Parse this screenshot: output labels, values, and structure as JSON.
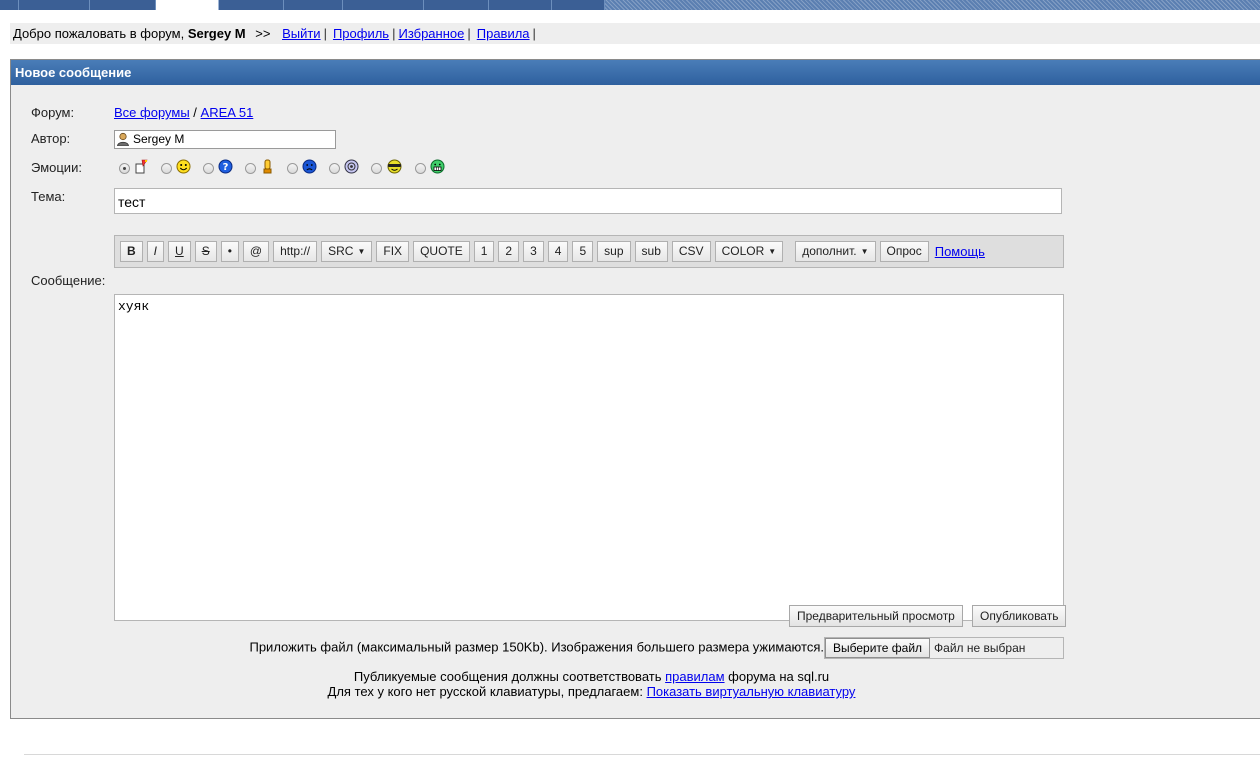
{
  "welcome": {
    "greeting": "Добро пожаловать в форум,",
    "username": "Sergey M",
    "arrows": ">>",
    "links": [
      "Выйти",
      "Профиль",
      "Избранное",
      "Правила"
    ],
    "separator": "|"
  },
  "panel": {
    "title": "Новое сообщение"
  },
  "form": {
    "forum_label": "Форум:",
    "forum_path": [
      "Все форумы",
      "AREA 51"
    ],
    "forum_path_sep": "/",
    "author_label": "Автор:",
    "author_value": "Sergey M",
    "emotions_label": "Эмоции:",
    "emotions": [
      {
        "icon": "pencil-note-icon",
        "checked": true
      },
      {
        "icon": "smiley-icon",
        "checked": false
      },
      {
        "icon": "question-face-icon",
        "checked": false
      },
      {
        "icon": "thumbs-up-icon",
        "checked": false
      },
      {
        "icon": "sad-face-icon",
        "checked": false
      },
      {
        "icon": "dizzy-face-icon",
        "checked": false
      },
      {
        "icon": "cool-face-icon",
        "checked": false
      },
      {
        "icon": "grin-face-icon",
        "checked": false
      }
    ],
    "subject_label": "Тема:",
    "subject_value": "тест",
    "message_label": "Сообщение:",
    "message_value": "хуяк"
  },
  "toolbar": {
    "buttons": [
      "B",
      "I",
      "U",
      "S",
      "•",
      "@",
      "http://",
      "SRC",
      "FIX",
      "QUOTE",
      "1",
      "2",
      "3",
      "4",
      "5",
      "sup",
      "sub",
      "CSV",
      "COLOR",
      "дополнит.",
      "Опрос"
    ],
    "dropdowns": [
      "SRC",
      "COLOR",
      "дополнит."
    ],
    "help_link": "Помощь"
  },
  "actions": {
    "preview": "Предварительный просмотр",
    "publish": "Опубликовать"
  },
  "attach": {
    "text": "Приложить файл (максимальный размер 150Kb). Изображения большего размера ужимаются.",
    "choose_button": "Выберите файл",
    "status": "Файл не выбран"
  },
  "notes": {
    "line1_before": "Публикуемые сообщения должны соответствовать",
    "line1_link": "правилам",
    "line1_after": "форума на sql.ru",
    "line2_before": "Для тех у кого нет русской клавиатуры, предлагаем:",
    "line2_link": "Показать виртуальную клавиатуру"
  },
  "colors": {
    "header_blue": "#2e609e",
    "panel_bg": "#eeeeee",
    "link": "#0000ee"
  }
}
